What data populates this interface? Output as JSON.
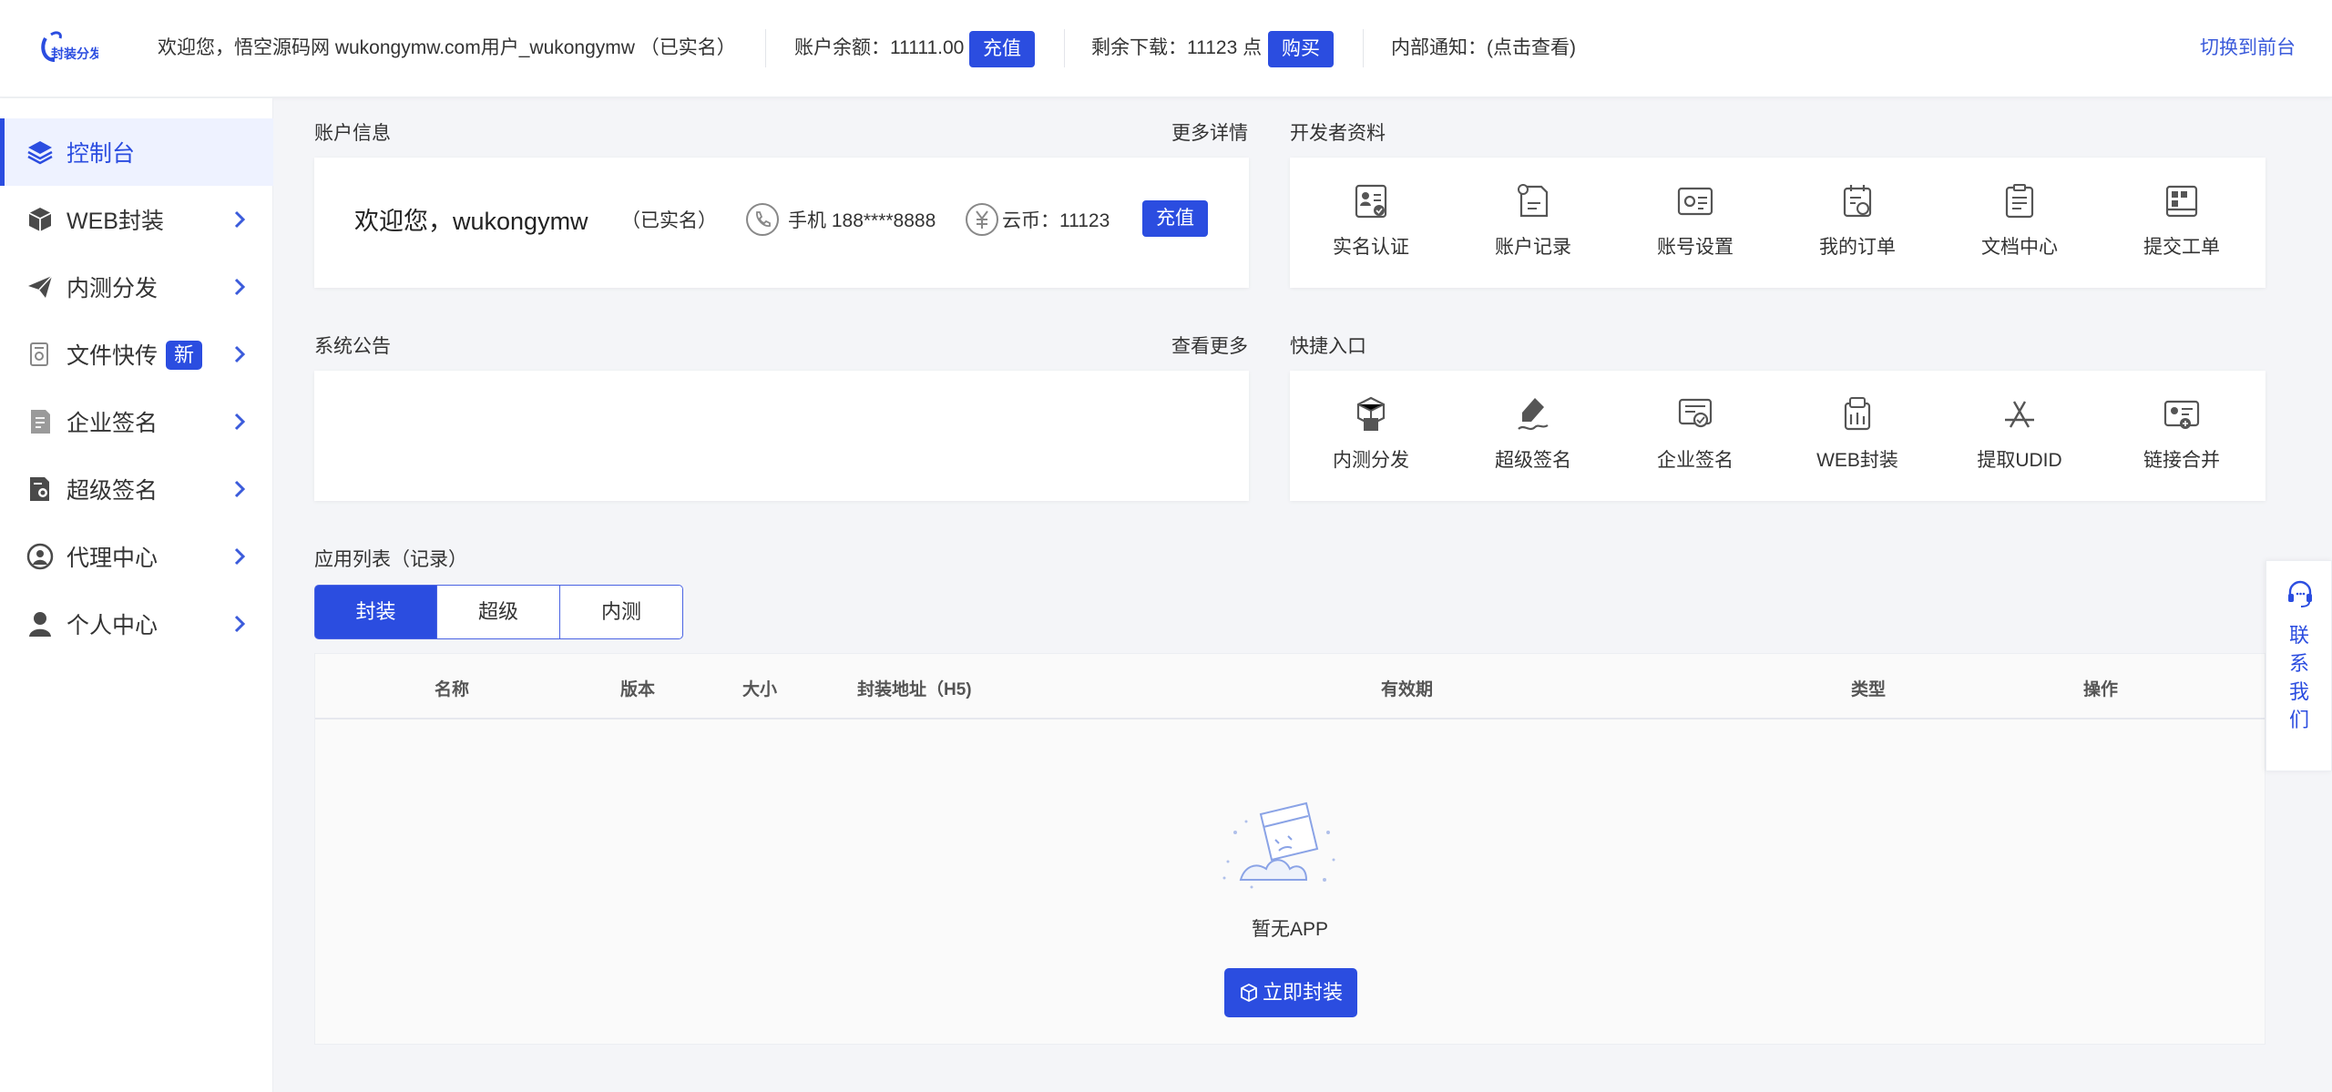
{
  "topbar": {
    "welcome": "欢迎您，悟空源码网 wukongymw.com用户_wukongymw （已实名）",
    "balance_label": "账户余额：11111.00",
    "recharge_btn": "充值",
    "downloads_label": "剩余下载：11123 点",
    "buy_btn": "购买",
    "notice": "内部通知：(点击查看)",
    "switch_frontend": "切换到前台",
    "logo_icon": "brand-logo-icon"
  },
  "sidebar": {
    "items": [
      {
        "label": "控制台",
        "icon": "layers-icon",
        "active": true
      },
      {
        "label": "WEB封装",
        "icon": "cube-icon"
      },
      {
        "label": "内测分发",
        "icon": "paper-plane-icon"
      },
      {
        "label": "文件快传",
        "icon": "file-transfer-icon",
        "badge": "新"
      },
      {
        "label": "企业签名",
        "icon": "document-sign-icon"
      },
      {
        "label": "超级签名",
        "icon": "certificate-icon"
      },
      {
        "label": "代理中心",
        "icon": "agent-icon"
      },
      {
        "label": "个人中心",
        "icon": "user-icon"
      }
    ]
  },
  "account": {
    "title": "账户信息",
    "more": "更多详情",
    "greeting": "欢迎您，wukongymw",
    "verified": "（已实名）",
    "phone": "手机 188****8888",
    "coins": "云币：11123",
    "recharge_btn": "充值"
  },
  "developer": {
    "title": "开发者资料",
    "items": [
      {
        "label": "实名认证",
        "icon": "id-verify-icon"
      },
      {
        "label": "账户记录",
        "icon": "account-record-icon"
      },
      {
        "label": "账号设置",
        "icon": "settings-card-icon"
      },
      {
        "label": "我的订单",
        "icon": "order-icon"
      },
      {
        "label": "文档中心",
        "icon": "clipboard-icon"
      },
      {
        "label": "提交工单",
        "icon": "ticket-icon"
      }
    ]
  },
  "announcement": {
    "title": "系统公告",
    "more": "查看更多"
  },
  "quick": {
    "title": "快捷入口",
    "items": [
      {
        "label": "内测分发",
        "icon": "boxes-icon"
      },
      {
        "label": "超级签名",
        "icon": "pen-sign-icon"
      },
      {
        "label": "企业签名",
        "icon": "enterprise-cert-icon"
      },
      {
        "label": "WEB封装",
        "icon": "package-icon"
      },
      {
        "label": "提取UDID",
        "icon": "app-store-icon"
      },
      {
        "label": "链接合并",
        "icon": "link-merge-icon"
      }
    ]
  },
  "apps": {
    "title": "应用列表（记录）",
    "tabs": [
      "封装",
      "超级",
      "内测"
    ],
    "active_tab": "封装",
    "columns": [
      "名称",
      "版本",
      "大小",
      "封装地址（H5)",
      "有效期",
      "类型",
      "操作"
    ],
    "empty_text": "暂无APP",
    "empty_btn": "立即封装"
  },
  "chat": {
    "label": "联系我们",
    "icon": "headset-icon"
  },
  "colors": {
    "primary": "#2b4de0",
    "link": "#3b5bdb",
    "background": "#f4f5f8"
  }
}
